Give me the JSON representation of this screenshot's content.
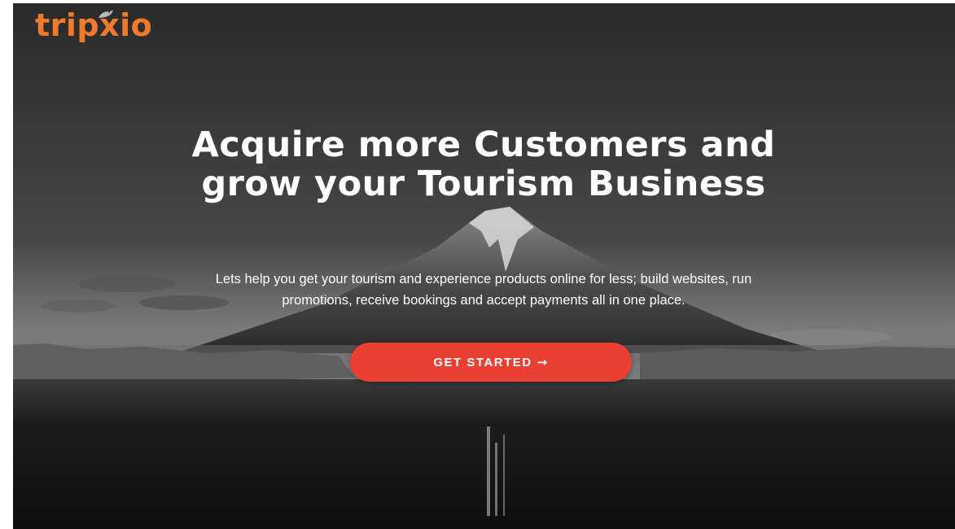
{
  "brand": {
    "name": "tripxio",
    "color": "#f07a2c"
  },
  "hero": {
    "headline": "Acquire more Customers and grow your Tourism Business",
    "subtext": "Lets help you get your tourism and experience products online for less; build websites, run promotions, receive bookings and accept payments all in one place.",
    "cta_label": "GET STARTED",
    "cta_icon": "arrow-right-icon",
    "cta_color": "#ea3f33"
  },
  "icons": {
    "logo_mark": "bird-icon",
    "cta_arrow": "→"
  }
}
